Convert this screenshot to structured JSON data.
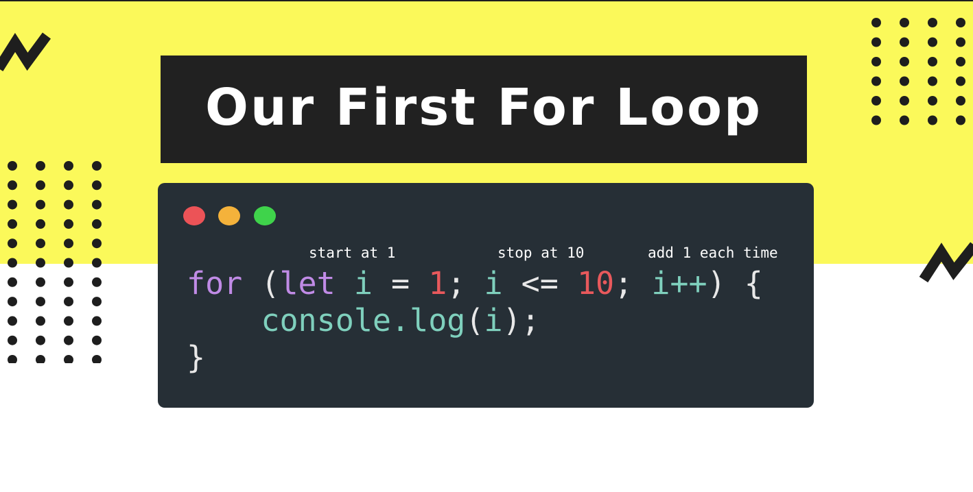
{
  "slide": {
    "title": "Our First For Loop"
  },
  "annotations": {
    "start": "start at 1",
    "stop": "stop at 10",
    "step": "add 1 each time"
  },
  "code": {
    "line1": {
      "kw_for": "for",
      "p1": " (",
      "kw_let": "let",
      "sp1": " ",
      "var1": "i",
      "p2": " = ",
      "num1": "1",
      "p3": "; ",
      "var2": "i",
      "p4": " <= ",
      "num2": "10",
      "p5": "; ",
      "var3": "i++",
      "p6": ") {"
    },
    "line2": {
      "indent": "    ",
      "fn": "console.log",
      "p1": "(",
      "arg": "i",
      "p2": ");"
    },
    "line3": {
      "brace": "}"
    }
  },
  "colors": {
    "background_yellow": "#fbf95a",
    "banner": "#212121",
    "editor": "#262f36",
    "keyword": "#c08be6",
    "identifier": "#7fd0bd",
    "number": "#e8595c",
    "traffic_red": "#ec5357",
    "traffic_yellow": "#f4b23b",
    "traffic_green": "#3fd34b"
  }
}
